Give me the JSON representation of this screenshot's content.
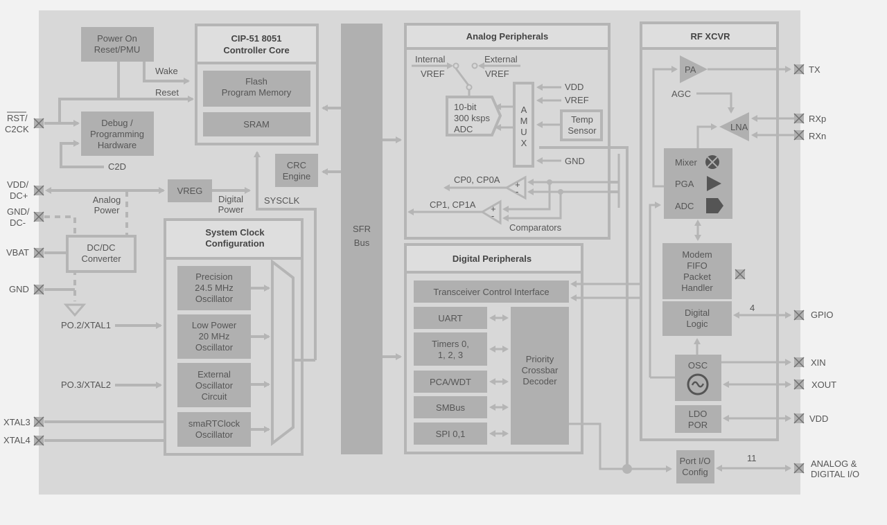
{
  "colors": {
    "page_background": "#f2f2f2",
    "chip_background": "#d8d8d8",
    "block_fill": "#b0b0b0",
    "wire": "#b5b5b5",
    "text": "#555555",
    "icon_dark": "#555555"
  },
  "pins_left": {
    "rst_c2ck": [
      "RST/",
      "C2CK"
    ],
    "vdd_dc_plus": [
      "VDD/",
      "DC+"
    ],
    "gnd_dc_minus": [
      "GND/",
      "DC-"
    ],
    "vbat": "VBAT",
    "gnd": "GND",
    "xtal3": "XTAL3",
    "xtal4": "XTAL4"
  },
  "pins_right": {
    "tx": "TX",
    "rxp": "RXp",
    "rxn": "RXn",
    "gpio": "GPIO",
    "xin": "XIN",
    "xout": "XOUT",
    "vdd": "VDD",
    "analog_digital_io": [
      "ANALOG &",
      "DIGITAL I/O"
    ]
  },
  "bus_widths": {
    "gpio": "4",
    "port_io": "11"
  },
  "power_reset": {
    "por_pmu": [
      "Power On",
      "Reset/PMU"
    ],
    "wake": "Wake",
    "reset": "Reset",
    "debug": [
      "Debug /",
      "Programming",
      "Hardware"
    ],
    "c2d": "C2D",
    "vreg": "VREG",
    "analog_power": [
      "Analog",
      "Power"
    ],
    "digital_power": [
      "Digital",
      "Power"
    ],
    "dcdc": [
      "DC/DC",
      "Converter"
    ]
  },
  "clock_inputs": {
    "xtal1": "PO.2/XTAL1",
    "xtal2": "PO.3/XTAL2",
    "sysclk": "SYSCLK"
  },
  "core": {
    "title": [
      "CIP-51 8051",
      "Controller Core"
    ],
    "flash": [
      "Flash",
      "Program Memory"
    ],
    "sram": "SRAM",
    "crc": [
      "CRC",
      "Engine"
    ]
  },
  "clock_config": {
    "title": [
      "System Clock",
      "Configuration"
    ],
    "oscillators": [
      [
        "Precision",
        "24.5 MHz",
        "Oscillator"
      ],
      [
        "Low Power",
        "20 MHz",
        "Oscillator"
      ],
      [
        "External",
        "Oscillator",
        "Circuit"
      ],
      [
        "smaRTClock",
        "Oscillator"
      ]
    ]
  },
  "sfr_bus": [
    "SFR",
    "Bus"
  ],
  "analog": {
    "title": "Analog Peripherals",
    "internal_vref": [
      "Internal",
      "VREF"
    ],
    "external_vref": [
      "External",
      "VREF"
    ],
    "adc": [
      "10-bit",
      "300 ksps",
      "ADC"
    ],
    "amux": [
      "A",
      "M",
      "U",
      "X"
    ],
    "amux_inputs": [
      "VDD",
      "VREF",
      "GND"
    ],
    "temp_sensor": [
      "Temp",
      "Sensor"
    ],
    "cp0": "CP0, CP0A",
    "cp1": "CP1, CP1A",
    "comparators": "Comparators",
    "comparator_sign": [
      "+",
      "-"
    ]
  },
  "digital": {
    "title": "Digital Peripherals",
    "tci": "Transceiver Control Interface",
    "blocks": [
      [
        "UART"
      ],
      [
        "Timers 0,",
        "1, 2, 3"
      ],
      [
        "PCA/WDT"
      ],
      [
        "SMBus"
      ],
      [
        "SPI 0,1"
      ]
    ],
    "crossbar": [
      "Priority",
      "Crossbar",
      "Decoder"
    ]
  },
  "rf": {
    "title": "RF XCVR",
    "pa": "PA",
    "agc": "AGC",
    "lna": "LNA",
    "mixer": "Mixer",
    "pga": "PGA",
    "adc": "ADC",
    "modem": [
      "Modem",
      "FIFO",
      "Packet",
      "Handler"
    ],
    "digital_logic": [
      "Digital",
      "Logic"
    ],
    "osc": "OSC",
    "ldo": [
      "LDO",
      "POR"
    ]
  },
  "port_io": [
    "Port I/O",
    "Config"
  ]
}
